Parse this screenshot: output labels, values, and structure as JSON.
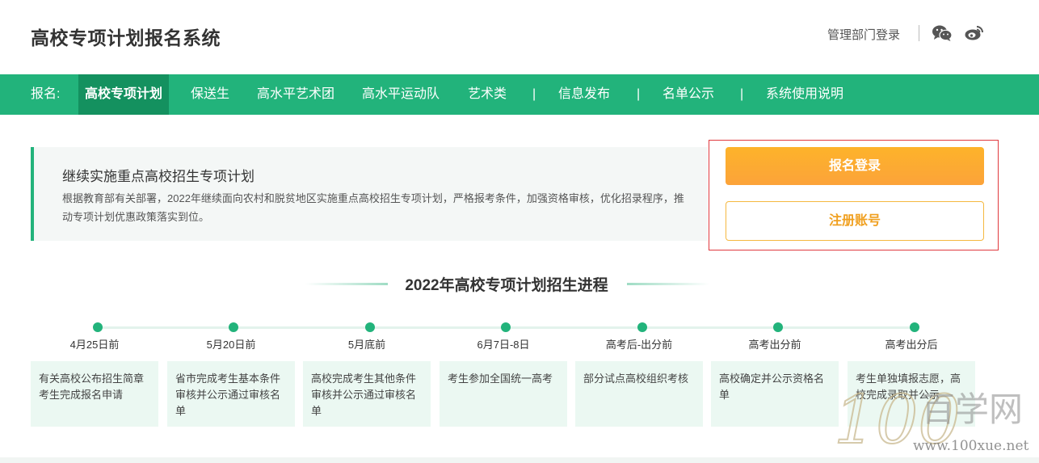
{
  "header": {
    "title": "高校专项计划报名系统",
    "admin_login": "管理部门登录",
    "icons": [
      "wechat-icon",
      "weibo-icon"
    ]
  },
  "nav": {
    "prefix": "报名:",
    "items": [
      {
        "label": "高校专项计划",
        "active": true
      },
      {
        "label": "保送生"
      },
      {
        "label": "高水平艺术团"
      },
      {
        "label": "高水平运动队"
      },
      {
        "label": "艺术类"
      },
      {
        "label": "信息发布"
      },
      {
        "label": "名单公示"
      },
      {
        "label": "系统使用说明"
      }
    ],
    "separator": "|"
  },
  "intro": {
    "title": "继续实施重点高校招生专项计划",
    "text": "根据教育部有关部署，2022年继续面向农村和脱贫地区实施重点高校招生专项计划，严格报考条件，加强资格审核，优化招录程序，推动专项计划优惠政策落实到位。"
  },
  "auth": {
    "login_label": "报名登录",
    "register_label": "注册账号"
  },
  "progress": {
    "title": "2022年高校专项计划招生进程",
    "steps": [
      {
        "date": "4月25日前",
        "desc": "有关高校公布招生简章考生完成报名申请"
      },
      {
        "date": "5月20日前",
        "desc": "省市完成考生基本条件审核并公示通过审核名单"
      },
      {
        "date": "5月底前",
        "desc": "高校完成考生其他条件审核并公示通过审核名单"
      },
      {
        "date": "6月7日-8日",
        "desc": "考生参加全国统一高考"
      },
      {
        "date": "高考后-出分前",
        "desc": "部分试点高校组织考核"
      },
      {
        "date": "高考出分前",
        "desc": "高校确定并公示资格名单"
      },
      {
        "date": "高考出分后",
        "desc": "考生单独填报志愿，高校完成录取并公示"
      }
    ]
  },
  "watermark": {
    "brand": "百学网",
    "url": "www.100xue.net"
  },
  "colors": {
    "primary": "#22b37b",
    "primary_dark": "#14915f",
    "orange": "#fca33a",
    "highlight_border": "#e0393e"
  }
}
